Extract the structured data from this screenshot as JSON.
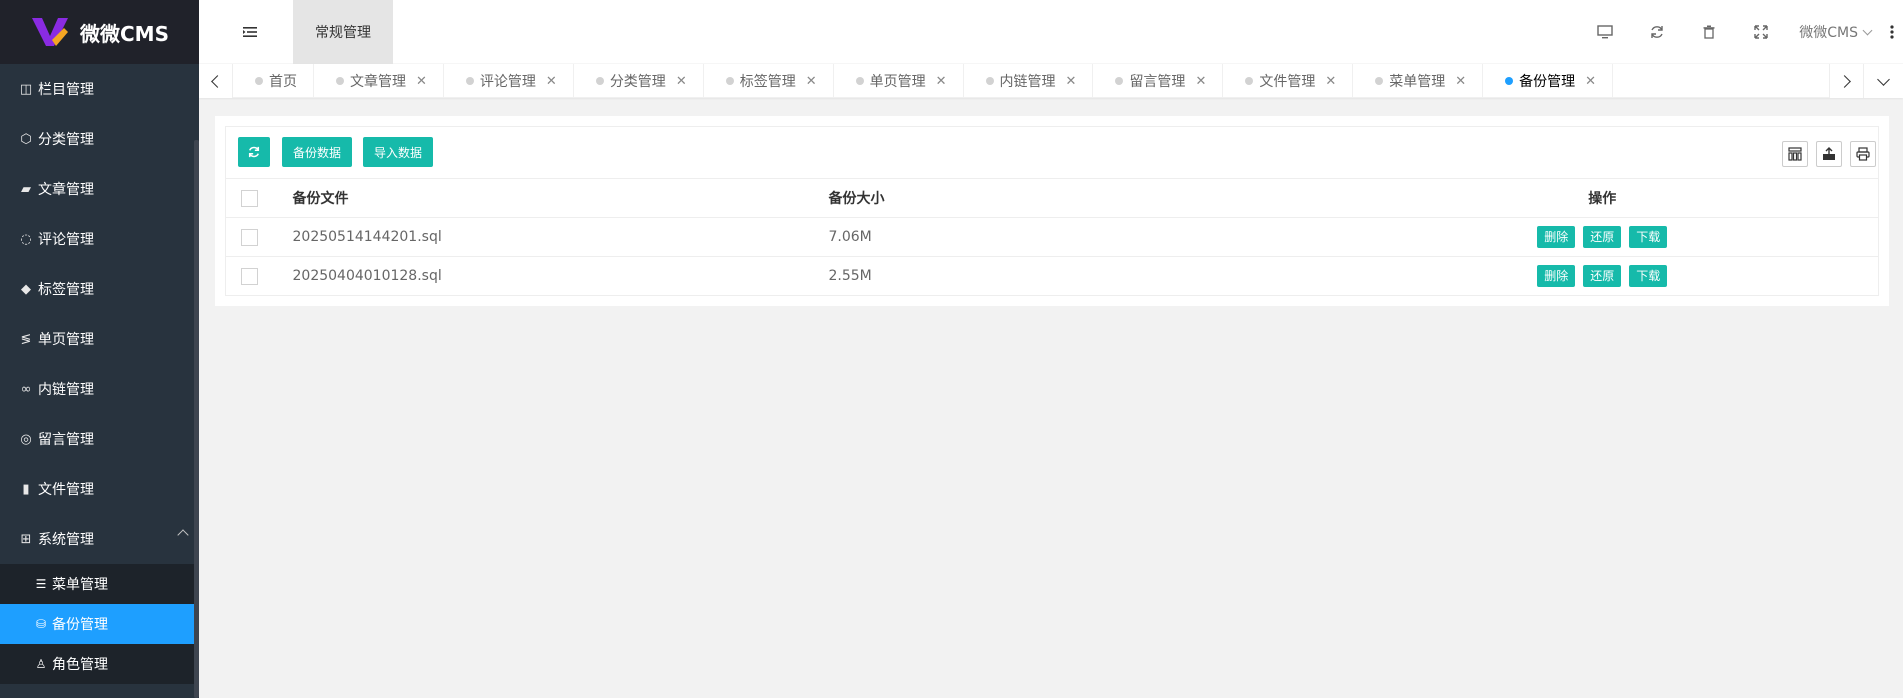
{
  "app": {
    "name": "微微CMS"
  },
  "sidebar": {
    "items": [
      {
        "label": "栏目管理",
        "icon": "columns-icon"
      },
      {
        "label": "分类管理",
        "icon": "cube-icon"
      },
      {
        "label": "文章管理",
        "icon": "book-icon"
      },
      {
        "label": "评论管理",
        "icon": "comment-icon"
      },
      {
        "label": "标签管理",
        "icon": "tags-icon"
      },
      {
        "label": "单页管理",
        "icon": "page-icon"
      },
      {
        "label": "内链管理",
        "icon": "link-icon"
      },
      {
        "label": "留言管理",
        "icon": "message-icon"
      },
      {
        "label": "文件管理",
        "icon": "file-icon"
      },
      {
        "label": "系统管理",
        "icon": "windows-icon"
      }
    ],
    "submenu": [
      {
        "label": "菜单管理",
        "icon": "list-icon",
        "active": false
      },
      {
        "label": "备份管理",
        "icon": "database-icon",
        "active": true
      },
      {
        "label": "角色管理",
        "icon": "user-icon",
        "active": false
      }
    ]
  },
  "header": {
    "section_tab": "常规管理",
    "user_label": "微微CMS"
  },
  "tabs": [
    {
      "label": "首页",
      "closable": false,
      "active": false
    },
    {
      "label": "文章管理",
      "closable": true,
      "active": false
    },
    {
      "label": "评论管理",
      "closable": true,
      "active": false
    },
    {
      "label": "分类管理",
      "closable": true,
      "active": false
    },
    {
      "label": "标签管理",
      "closable": true,
      "active": false
    },
    {
      "label": "单页管理",
      "closable": true,
      "active": false
    },
    {
      "label": "内链管理",
      "closable": true,
      "active": false
    },
    {
      "label": "留言管理",
      "closable": true,
      "active": false
    },
    {
      "label": "文件管理",
      "closable": true,
      "active": false
    },
    {
      "label": "菜单管理",
      "closable": true,
      "active": false
    },
    {
      "label": "备份管理",
      "closable": true,
      "active": true
    }
  ],
  "toolbar": {
    "backup_label": "备份数据",
    "import_label": "导入数据"
  },
  "table": {
    "columns": {
      "file": "备份文件",
      "size": "备份大小",
      "ops": "操作"
    },
    "rows": [
      {
        "file": "20250514144201.sql",
        "size": "7.06M"
      },
      {
        "file": "20250404010128.sql",
        "size": "2.55M"
      }
    ],
    "actions": {
      "delete": "删除",
      "restore": "还原",
      "download": "下载"
    }
  },
  "colors": {
    "sidebar": "#28333e",
    "logo_bg": "#20222a",
    "accent": "#16baaa",
    "active_blue": "#1e9fff"
  }
}
